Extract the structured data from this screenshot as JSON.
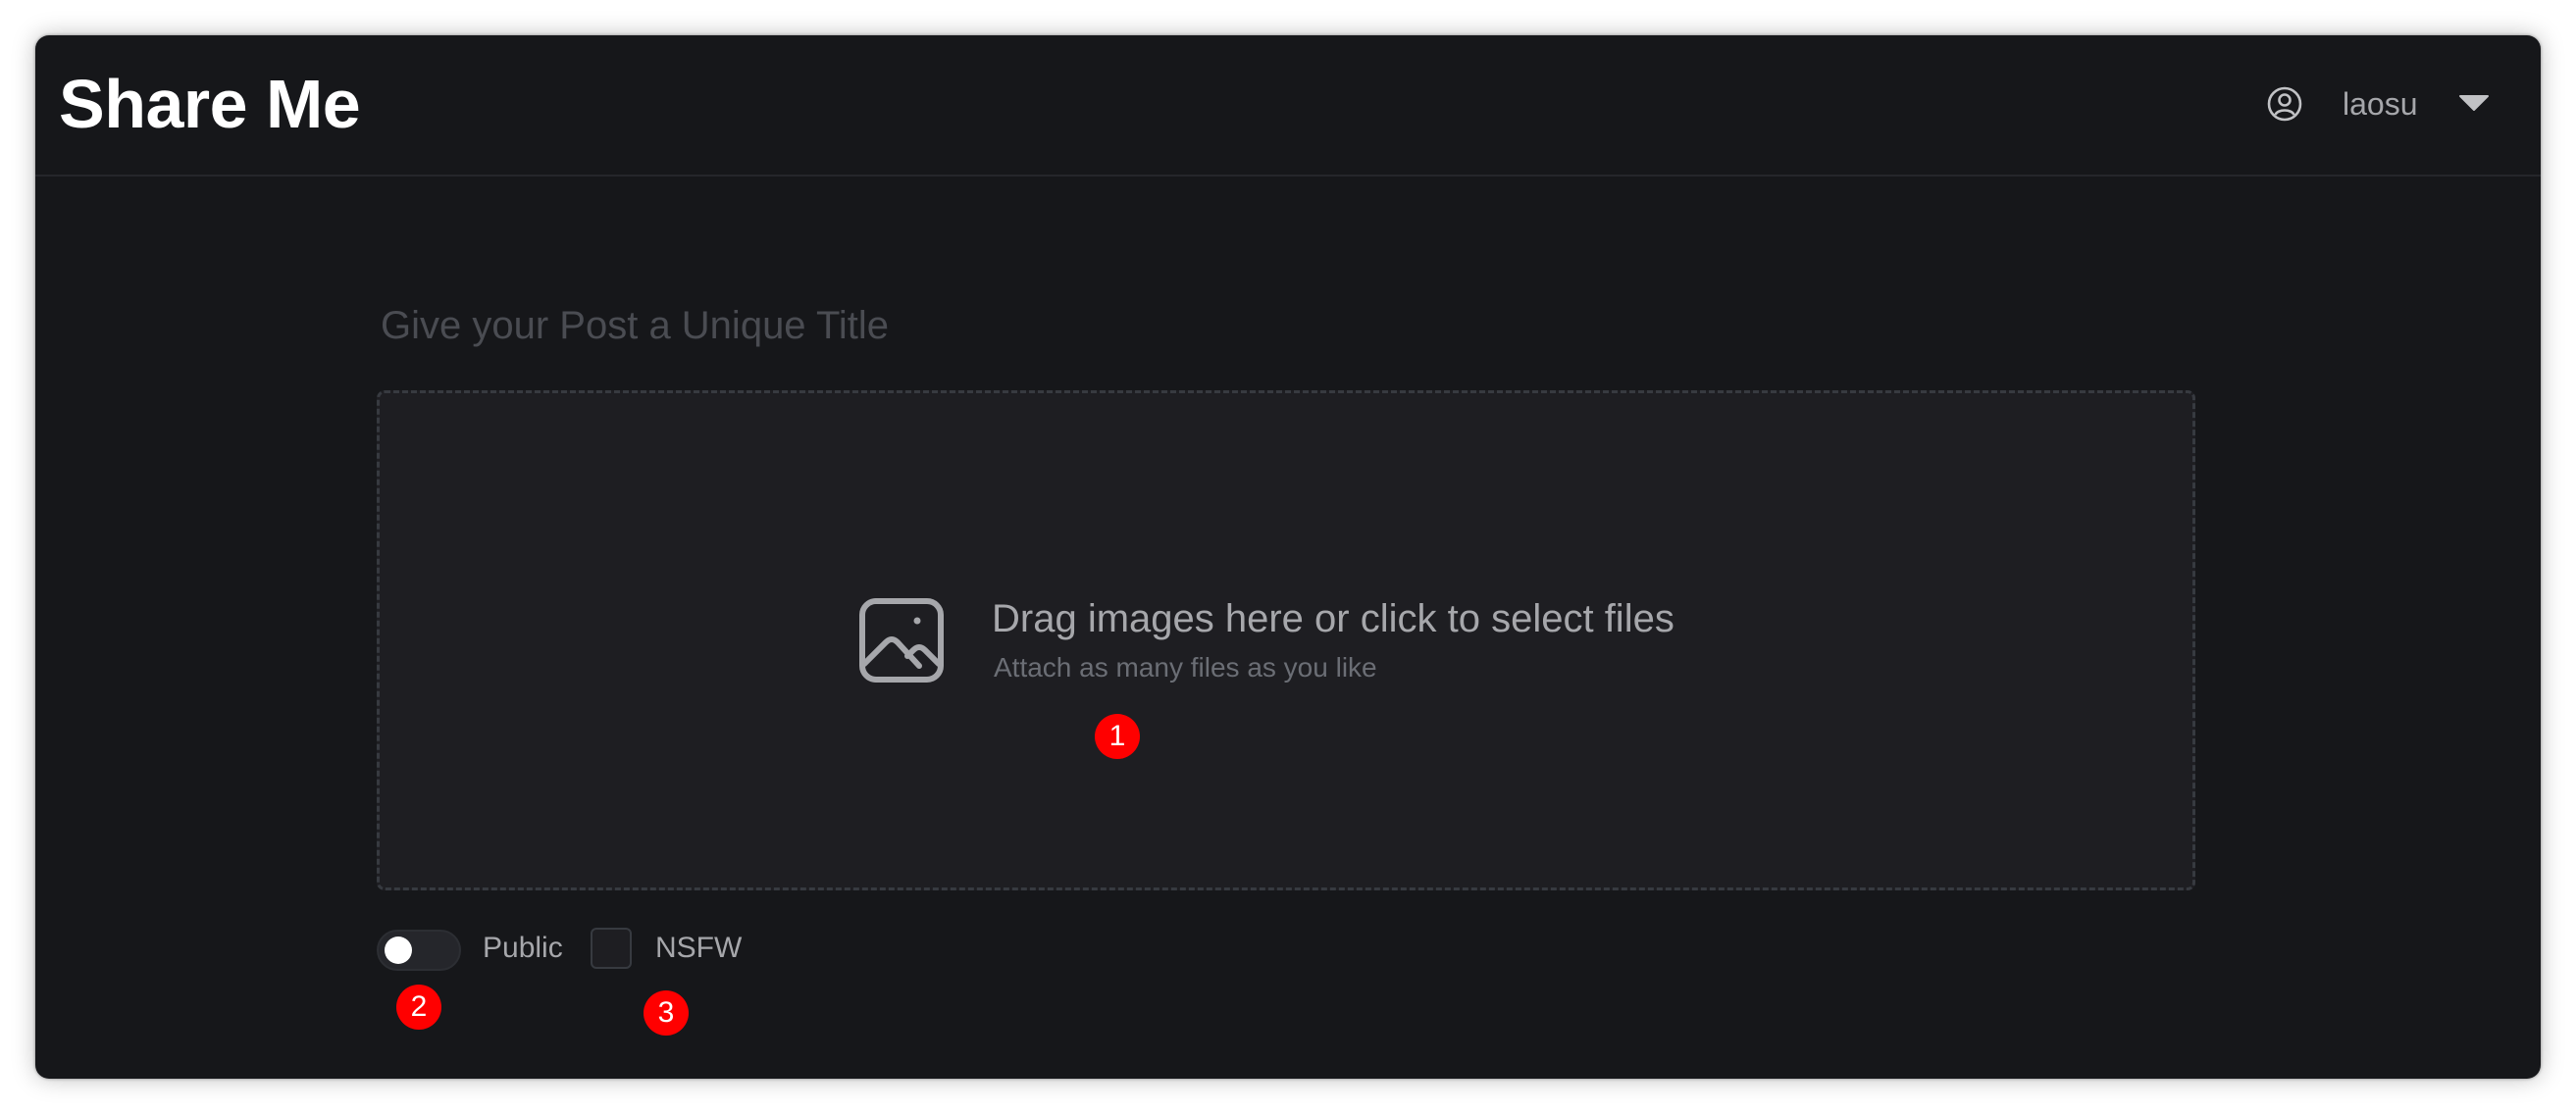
{
  "app": {
    "title": "Share Me"
  },
  "header": {
    "user_icon": "user-circle-icon",
    "username": "laosu",
    "menu_icon": "caret-down-icon"
  },
  "form": {
    "title_placeholder": "Give your Post a Unique Title",
    "title_value": "",
    "dropzone": {
      "icon": "image-icon",
      "title": "Drag images here or click to select files",
      "subtitle": "Attach as many files as you like"
    },
    "public": {
      "label": "Public",
      "checked": false
    },
    "nsfw": {
      "label": "NSFW",
      "checked": false
    }
  },
  "markers": [
    "1",
    "2",
    "3"
  ],
  "colors": {
    "background": "#16171a",
    "dropzone_bg": "#1e1e22",
    "text_muted": "#a6a7ab",
    "marker": "#ff0000"
  }
}
